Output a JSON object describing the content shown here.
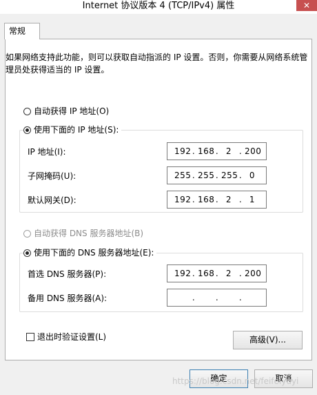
{
  "window": {
    "title": "Internet 协议版本 4 (TCP/IPv4) 属性",
    "close_glyph": "✕"
  },
  "tabs": [
    {
      "label": "常规"
    }
  ],
  "description": "如果网络支持此功能，则可以获取自动指派的 IP 设置。否则，你需要从网络系统管理员处获得适当的 IP 设置。",
  "ip_section": {
    "auto_option": {
      "label": "自动获得 IP 地址(O)",
      "checked": false
    },
    "manual_option": {
      "label": "使用下面的 IP 地址(S):",
      "checked": true
    },
    "fields": [
      {
        "label": "IP 地址(I):",
        "octets": [
          "192",
          "168",
          "2",
          "200"
        ]
      },
      {
        "label": "子网掩码(U):",
        "octets": [
          "255",
          "255",
          "255",
          "0"
        ]
      },
      {
        "label": "默认网关(D):",
        "octets": [
          "192",
          "168",
          "2",
          "1"
        ]
      }
    ]
  },
  "dns_section": {
    "auto_option": {
      "label": "自动获得 DNS 服务器地址(B)",
      "checked": false,
      "disabled": true
    },
    "manual_option": {
      "label": "使用下面的 DNS 服务器地址(E):",
      "checked": true
    },
    "fields": [
      {
        "label": "首选 DNS 服务器(P):",
        "octets": [
          "192",
          "168",
          "2",
          "200"
        ]
      },
      {
        "label": "备用 DNS 服务器(A):",
        "octets": [
          "",
          "",
          "",
          ""
        ]
      }
    ]
  },
  "validate_checkbox": {
    "label": "退出时验证设置(L)",
    "checked": false
  },
  "buttons": {
    "advanced": "高级(V)...",
    "ok": "确定",
    "cancel": "取消"
  },
  "watermark": "https://blog.csdn.net/feifeiyuyi"
}
